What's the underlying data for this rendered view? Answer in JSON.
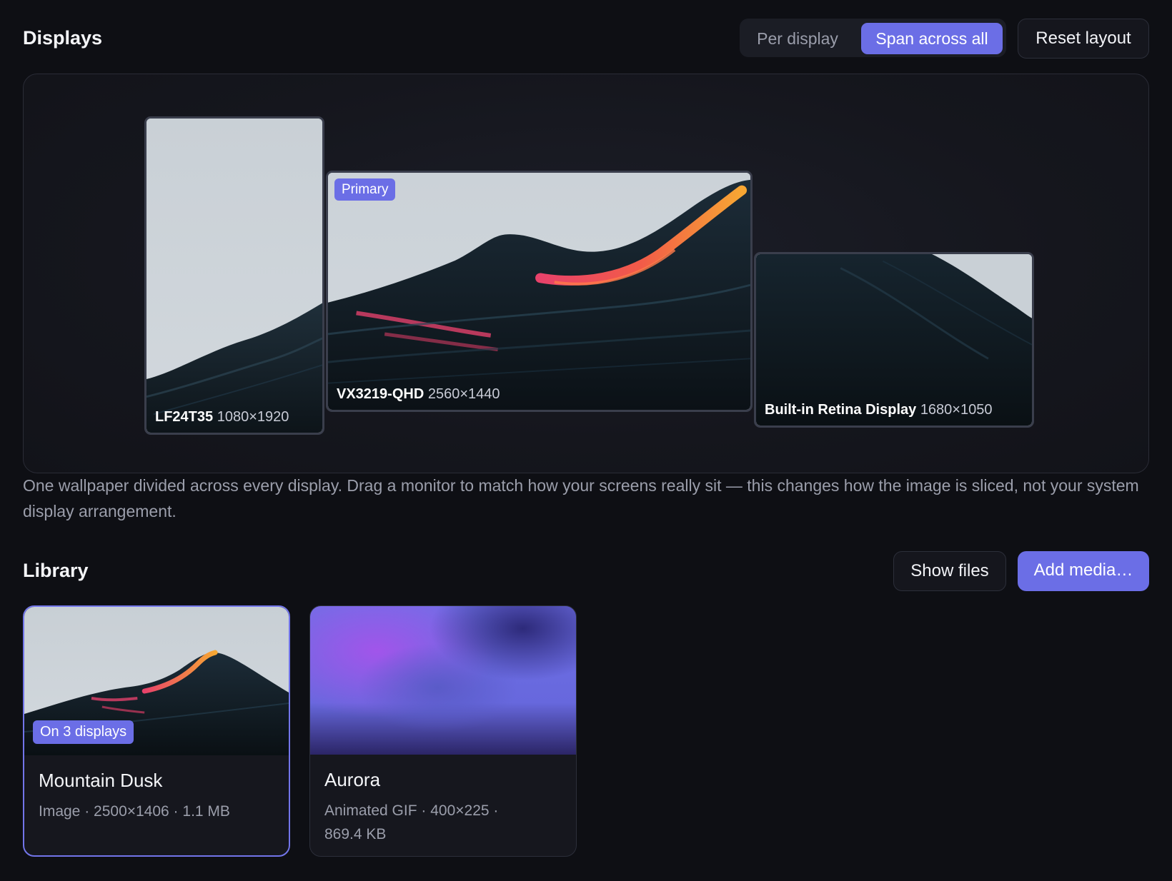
{
  "displays": {
    "title": "Displays",
    "modes": [
      "Per display",
      "Span across all"
    ],
    "active_mode": "Span across all",
    "reset_label": "Reset layout",
    "monitors": [
      {
        "name": "LF24T35",
        "resolution": "1080×1920"
      },
      {
        "name": "VX3219-QHD",
        "resolution": "2560×1440",
        "badge": "Primary"
      },
      {
        "name": "Built-in Retina Display",
        "resolution": "1680×1050"
      }
    ],
    "description": "One wallpaper divided across every display. Drag a monitor to match how your screens really sit — this changes how the image is sliced, not your system display arrangement."
  },
  "library": {
    "title": "Library",
    "show_files_label": "Show files",
    "add_media_label": "Add media…",
    "items": [
      {
        "title": "Mountain Dusk",
        "meta": "Image · 2500×1406 · 1.1 MB",
        "badge": "On 3 displays",
        "selected": true
      },
      {
        "title": "Aurora",
        "meta": "Animated GIF · 400×225 · 869.4 KB",
        "selected": false
      }
    ]
  },
  "colors": {
    "background": "#0e0f14",
    "accent": "#6b6ee6",
    "panel": "#15161d",
    "muted_text": "#9b9eab"
  }
}
